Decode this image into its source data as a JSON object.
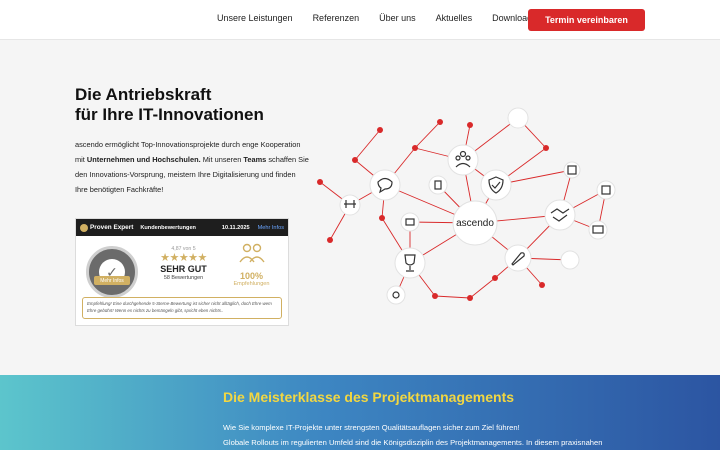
{
  "header": {
    "nav": [
      "Unsere Leistungen",
      "Referenzen",
      "Über uns",
      "Aktuelles",
      "Downloads"
    ],
    "cta_label": "Termin vereinbaren",
    "cta_color": "#d9292a"
  },
  "hero": {
    "title_line1": "Die Antriebskraft",
    "title_line2": "für Ihre IT-Innovationen",
    "text_1": "ascendo ermöglicht Top-Innovationsprojekte durch enge Kooperation mit ",
    "text_bold_1": "Unternehmen und Hochschulen.",
    "text_2": " Mit unseren ",
    "text_bold_2": "Teams",
    "text_3": " schaffen Sie den Innovations-Vorsprung, meistern Ihre Digitalisierung und finden Ihre benötigten Fachkräfte!"
  },
  "proven_expert": {
    "logo": "Proven Expert",
    "heading": "Kundenbewertungen",
    "date": "10.11.2025",
    "more_link": "Mehr Infos",
    "seal_label": "Mehr Infos",
    "score_text": "4,87 von 5",
    "stars": 5,
    "verdict": "SEHR GUT",
    "review_count": "58 Bewertungen",
    "recommend_pct": "100%",
    "recommend_label": "Empfehlungen",
    "note": "Empfehlung! Eine durchgehende 5-Sterne-Bewertung ist sicher nicht alltäglich, doch Ehre wem Ehre gebührt! Wenn es nichts zu bemängeln gibt, spricht eben nichts..",
    "accent": "#d1b062"
  },
  "network": {
    "center_label": "ascendo",
    "node_color": "#d9292a",
    "icons": [
      "chat-icon",
      "team-icon",
      "shield-check-icon",
      "handshake-icon",
      "trophy-icon",
      "rocket-icon",
      "drone-icon",
      "robot-icon",
      "document-icon",
      "calendar-icon",
      "server-icon",
      "monitor-icon",
      "gear-icon"
    ]
  },
  "band": {
    "title": "Die Meisterklasse des Projektmanagements",
    "line1": "Wie Sie komplexe IT-Projekte unter strengsten Qualitätsauflagen sicher zum Ziel führen!",
    "line2": "Globale Rollouts im regulierten Umfeld sind die Königsdisziplin des Projektmanagements. In diesem praxisnahen"
  }
}
